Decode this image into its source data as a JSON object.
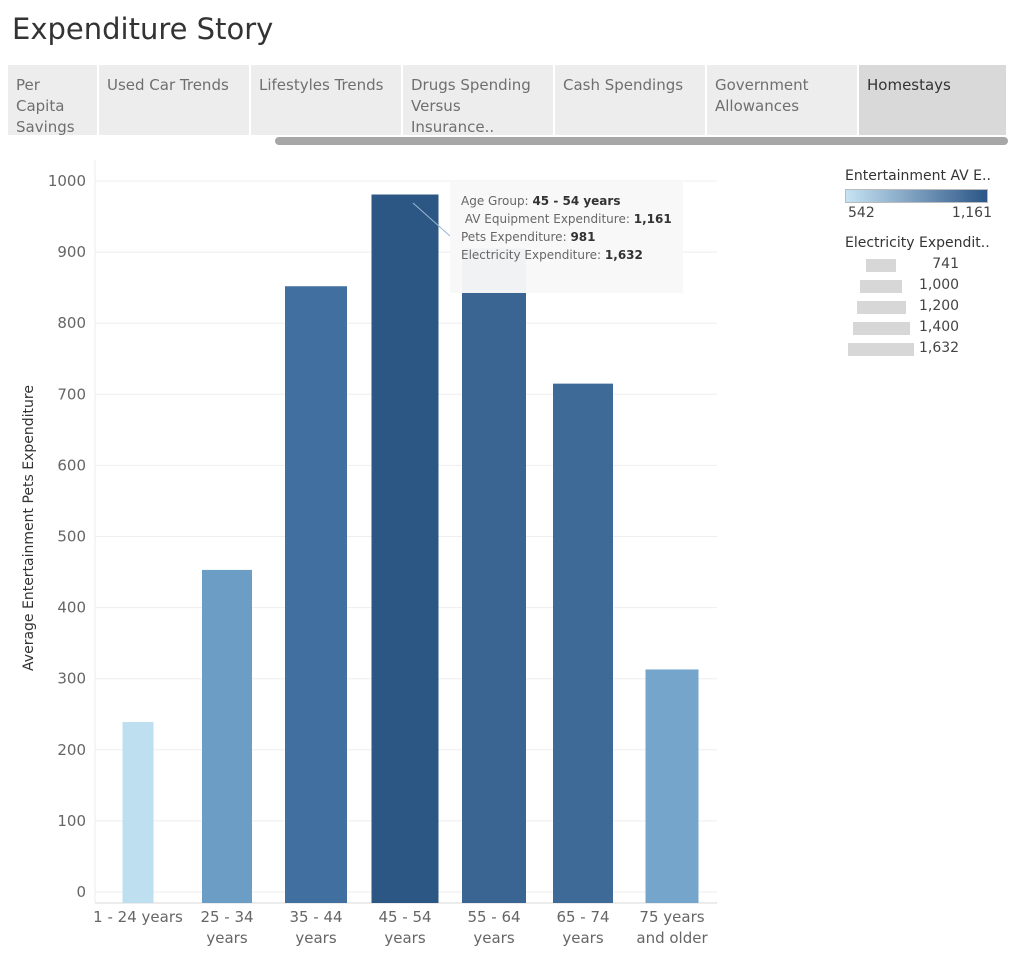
{
  "story_title": "Expenditure Story",
  "tabs": [
    {
      "label": "Per Capita Savings",
      "active": false
    },
    {
      "label": "Used Car Trends",
      "active": false
    },
    {
      "label": "Lifestyles Trends",
      "active": false
    },
    {
      "label": "Drugs Spending Versus Insurance..",
      "active": false
    },
    {
      "label": "Cash Spendings",
      "active": false
    },
    {
      "label": "Government Allowances",
      "active": false
    },
    {
      "label": "Homestays",
      "active": true
    }
  ],
  "chart_data": {
    "type": "bar",
    "ylabel": "Average Entertainment Pets Expenditure",
    "ylim": [
      0,
      1000
    ],
    "yticks": [
      0,
      100,
      200,
      300,
      400,
      500,
      600,
      700,
      800,
      900,
      1000
    ],
    "categories": [
      [
        "1 - 24 years"
      ],
      [
        "25 - 34",
        "years"
      ],
      [
        "35 - 44",
        "years"
      ],
      [
        "45 - 54",
        "years"
      ],
      [
        "55 - 64",
        "years"
      ],
      [
        "65 - 74",
        "years"
      ],
      [
        "75 years",
        "and older"
      ]
    ],
    "values": [
      239,
      453,
      852,
      981,
      905,
      715,
      313
    ],
    "colors": [
      "#bddfef",
      "#6b9dc5",
      "#4170a0",
      "#2c5784",
      "#3a6593",
      "#3d6a96",
      "#75a5cb"
    ],
    "grid": true
  },
  "tooltip": {
    "rows": [
      {
        "label": "Age Group:",
        "value": "45 - 54 years"
      },
      {
        "label": " AV Equipment Expenditure:",
        "value": "1,161"
      },
      {
        "label": "Pets Expenditure:",
        "value": "981"
      },
      {
        "label": "Electricity Expenditure:",
        "value": "1,632"
      }
    ]
  },
  "legend": {
    "color_title": "Entertainment AV E..",
    "color_min": "542",
    "color_max": "1,161",
    "ramp_from": "#c6e3f3",
    "ramp_to": "#2b5686",
    "size_title": "Electricity Expendit..",
    "size_entries": [
      "741",
      "1,000",
      "1,200",
      "1,400",
      "1,632"
    ]
  }
}
